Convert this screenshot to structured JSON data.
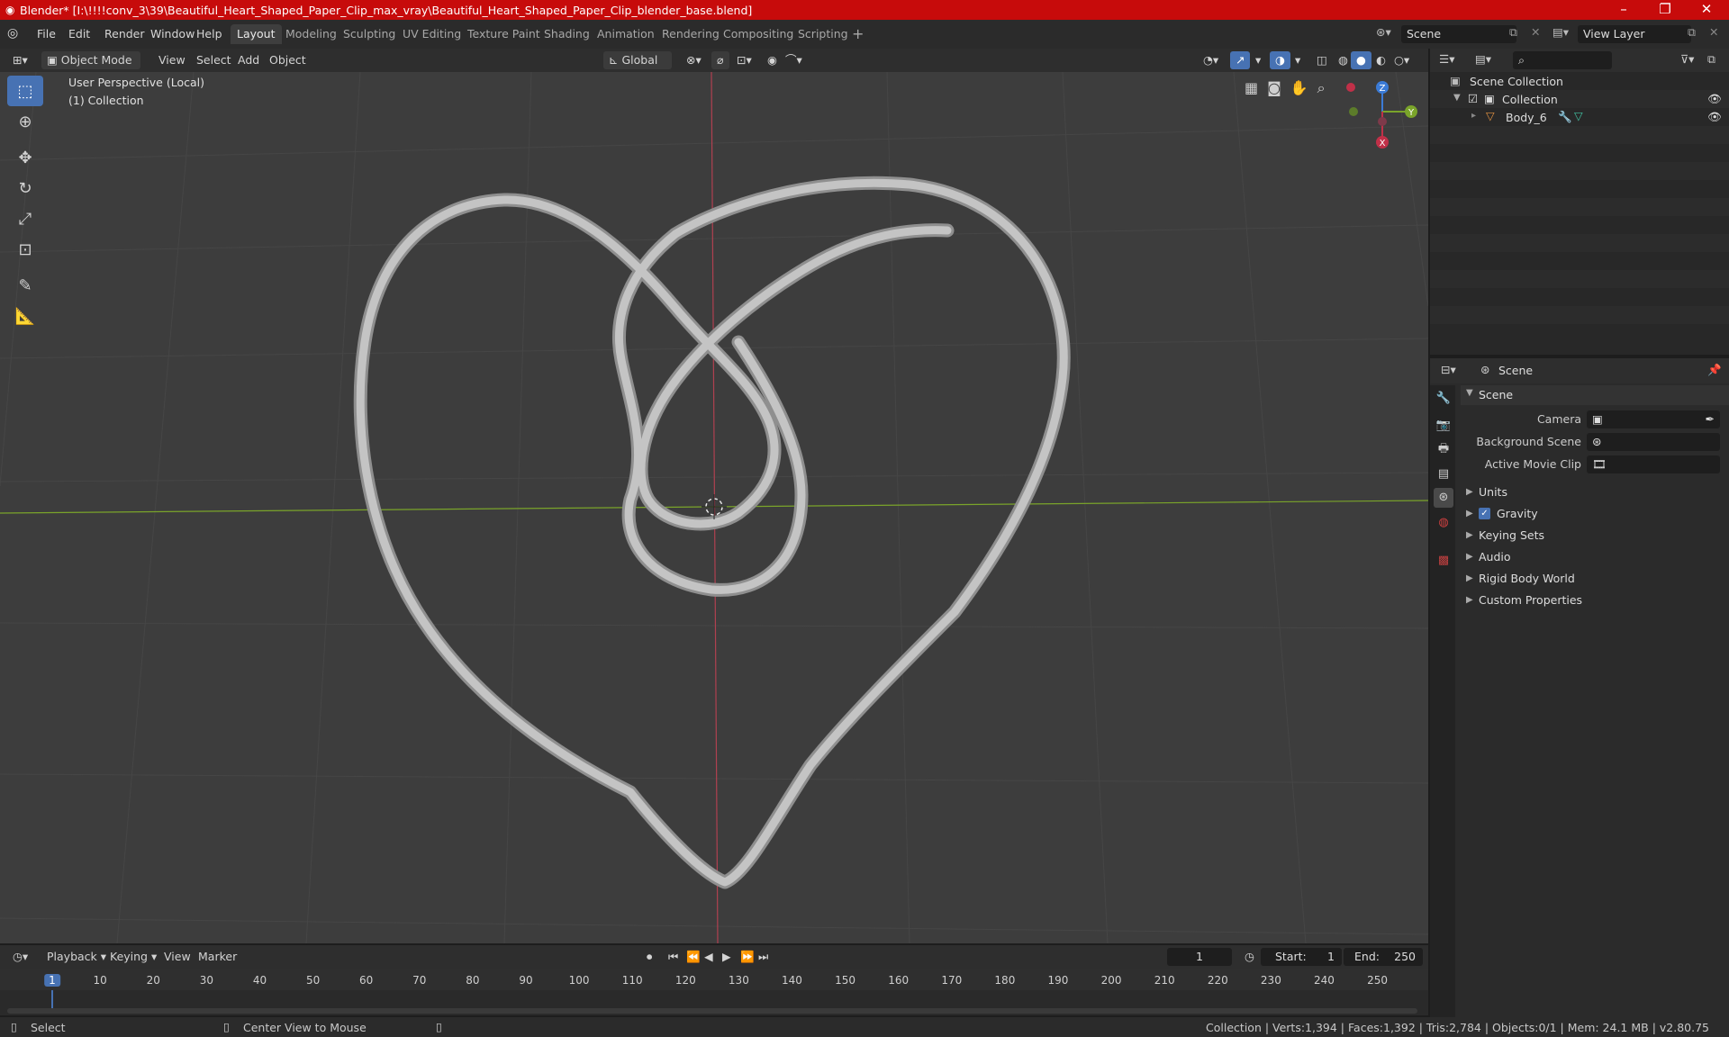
{
  "window": {
    "title": "Blender* [I:\\!!!!conv_3\\39\\Beautiful_Heart_Shaped_Paper_Clip_max_vray\\Beautiful_Heart_Shaped_Paper_Clip_blender_base.blend]",
    "controls": [
      "–",
      "❐",
      "✕"
    ]
  },
  "menu": [
    "File",
    "Edit",
    "Render",
    "Window",
    "Help"
  ],
  "workspaces": [
    "Layout",
    "Modeling",
    "Sculpting",
    "UV Editing",
    "Texture Paint",
    "Shading",
    "Animation",
    "Rendering",
    "Compositing",
    "Scripting"
  ],
  "active_workspace": "Layout",
  "scene_field": "Scene",
  "view_layer_field": "View Layer",
  "viewport_header": {
    "mode": "Object Mode",
    "menus": [
      "View",
      "Select",
      "Add",
      "Object"
    ],
    "transform_orientation": "Global"
  },
  "viewport": {
    "perspective_label": "User Perspective (Local)",
    "collection_label": "(1) Collection",
    "gizmo_axes": {
      "x": "X",
      "y": "Y",
      "z": "Z"
    }
  },
  "tools": [
    "select-box",
    "cursor",
    "move",
    "rotate",
    "scale",
    "transform",
    "annotate",
    "measure"
  ],
  "outliner": {
    "root": "Scene Collection",
    "collection": "Collection",
    "object": "Body_6"
  },
  "properties": {
    "header": "Scene",
    "panel_title": "Scene",
    "fields": [
      {
        "label": "Camera"
      },
      {
        "label": "Background Scene"
      },
      {
        "label": "Active Movie Clip"
      }
    ],
    "sections": [
      "Units",
      "Gravity",
      "Keying Sets",
      "Audio",
      "Rigid Body World",
      "Custom Properties"
    ],
    "gravity_checked": true
  },
  "timeline": {
    "menus": [
      "Playback",
      "Keying",
      "View",
      "Marker"
    ],
    "current_frame": "1",
    "start_label": "Start:",
    "start": "1",
    "end_label": "End:",
    "end": "250",
    "ticks": [
      "1",
      "10",
      "20",
      "30",
      "40",
      "50",
      "60",
      "70",
      "80",
      "90",
      "100",
      "110",
      "120",
      "130",
      "140",
      "150",
      "160",
      "170",
      "180",
      "190",
      "200",
      "210",
      "220",
      "230",
      "240",
      "250"
    ]
  },
  "statusbar": {
    "left_action": "Select",
    "middle_action": "Center View to Mouse",
    "stats": "Collection | Verts:1,394 | Faces:1,392 | Tris:2,784 | Objects:0/1 | Mem: 24.1 MB | v2.80.75"
  },
  "colors": {
    "title_bar": "#c70b0b",
    "accent_blue": "#4772b3",
    "viewport_bg": "#3d3d3d",
    "x_axis": "#b04050",
    "y_axis": "#7aa42a"
  }
}
